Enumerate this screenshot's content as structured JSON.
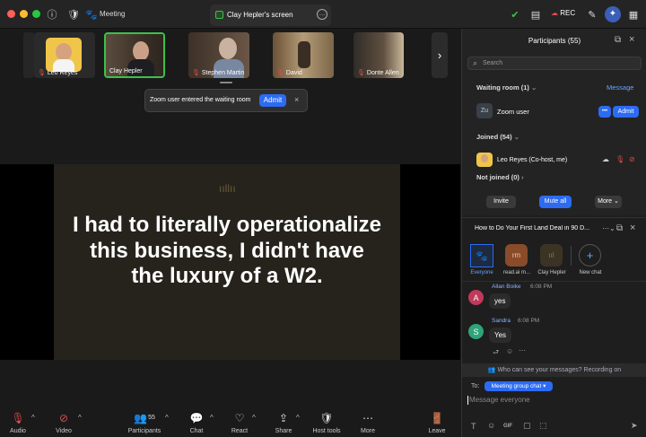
{
  "window": {
    "title": "Meeting",
    "share_title": "Clay Hepler's screen",
    "rec_label": "REC"
  },
  "colors": {
    "accent": "#2d6bf2",
    "red": "#e24a4a",
    "green": "#3cc14a",
    "close": "#ff5f57",
    "min": "#febc2e",
    "max": "#28c840"
  },
  "participants_strip": [
    {
      "name": "Leo Reyes"
    },
    {
      "name": "Clay Hepler"
    },
    {
      "name": "Stephen Martin"
    },
    {
      "name": "David"
    },
    {
      "name": "Donte Allen"
    }
  ],
  "notice": {
    "text": "Zoom user entered the waiting room",
    "admit": "Admit",
    "close": "×"
  },
  "slide": {
    "text": "I had to literally operationalize this business, I didn't have the luxury of a W2."
  },
  "toolbar": {
    "audio": "Audio",
    "video": "Video",
    "participants": "Participants",
    "participants_count": "55",
    "chat": "Chat",
    "react": "React",
    "share": "Share",
    "host_tools": "Host tools",
    "more": "More",
    "leave": "Leave"
  },
  "panel": {
    "title": "Participants (55)",
    "search_placeholder": "Search",
    "waiting_room": "Waiting room (1)",
    "message": "Message",
    "zoom_user": {
      "initials": "Zu",
      "name": "Zoom user",
      "dots": "•••",
      "admit": "Admit"
    },
    "joined": "Joined (54)",
    "joined_user": "Leo Reyes (Co-host, me)",
    "not_joined": "Not joined (0)",
    "invite": "Invite",
    "mute_all": "Mute all",
    "more": "More"
  },
  "chat": {
    "title": "How to Do Your First Land Deal in 90 D...",
    "targets": [
      {
        "label": "Everyone",
        "initials": "🐾"
      },
      {
        "label": "read.ai m...",
        "initials": "rm"
      },
      {
        "label": "Clay Hepler",
        "initials": ""
      },
      {
        "label": "New chat",
        "initials": "+"
      }
    ],
    "messages": [
      {
        "initial": "A",
        "sender": "Allan Boike",
        "time": "6:08 PM",
        "text": "yes",
        "color": "#c0395b"
      },
      {
        "initial": "S",
        "sender": "Sandra",
        "time": "6:08 PM",
        "text": "Yes",
        "color": "#2fa37a"
      }
    ],
    "visibility": "Who can see your messages? Recording on",
    "to_label": "To:",
    "to_target": "Meeting group chat",
    "input_placeholder": "Message everyone",
    "gif": "GIF"
  }
}
